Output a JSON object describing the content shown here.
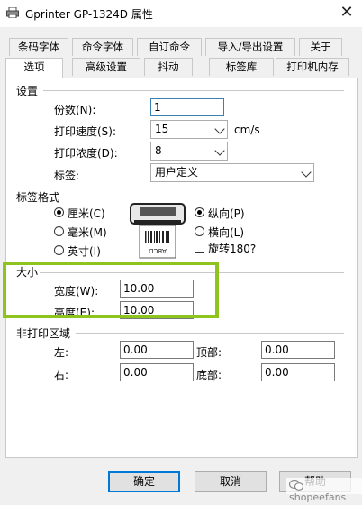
{
  "window": {
    "title": "Gprinter GP-1324D 属性",
    "close_symbol": "✕"
  },
  "tabs_row1": [
    "条码字体",
    "命令字体",
    "自订命令",
    "导入/导出设置",
    "关于"
  ],
  "tabs_row2": [
    "选项",
    "高级设置",
    "抖动",
    "标签库",
    "打印机内存"
  ],
  "settings": {
    "group_label": "设置",
    "copies_label": "份数(N):",
    "copies_value": "1",
    "speed_label": "打印速度(S):",
    "speed_value": "15",
    "speed_unit": "cm/s",
    "density_label": "打印浓度(D):",
    "density_value": "8",
    "label_label": "标签:",
    "label_value": "用户定义"
  },
  "label_format": {
    "group_label": "标签格式",
    "units": [
      "厘米(C)",
      "毫米(M)",
      "英寸(I)"
    ],
    "unit_selected": 0,
    "orientation": [
      "纵向(P)",
      "横向(L)"
    ],
    "orientation_selected": 0,
    "rotate_label": "旋转180?",
    "label_image_text": "ABCD"
  },
  "size": {
    "group_label": "大小",
    "width_label": "宽度(W):",
    "width_value": "10.00",
    "height_label": "高度(E):",
    "height_value": "10.00"
  },
  "nonprint": {
    "group_label": "非打印区域",
    "left_label": "左:",
    "left_value": "0.00",
    "top_label": "顶部:",
    "top_value": "0.00",
    "right_label": "右:",
    "right_value": "0.00",
    "bottom_label": "底部:",
    "bottom_value": "0.00"
  },
  "buttons": {
    "ok": "确定",
    "cancel": "取消",
    "help": "帮助"
  },
  "watermark": "shopeefans",
  "colors": {
    "highlight": "#8fc31f",
    "focus": "#3c7fb1",
    "default_button": "#0078d7"
  }
}
